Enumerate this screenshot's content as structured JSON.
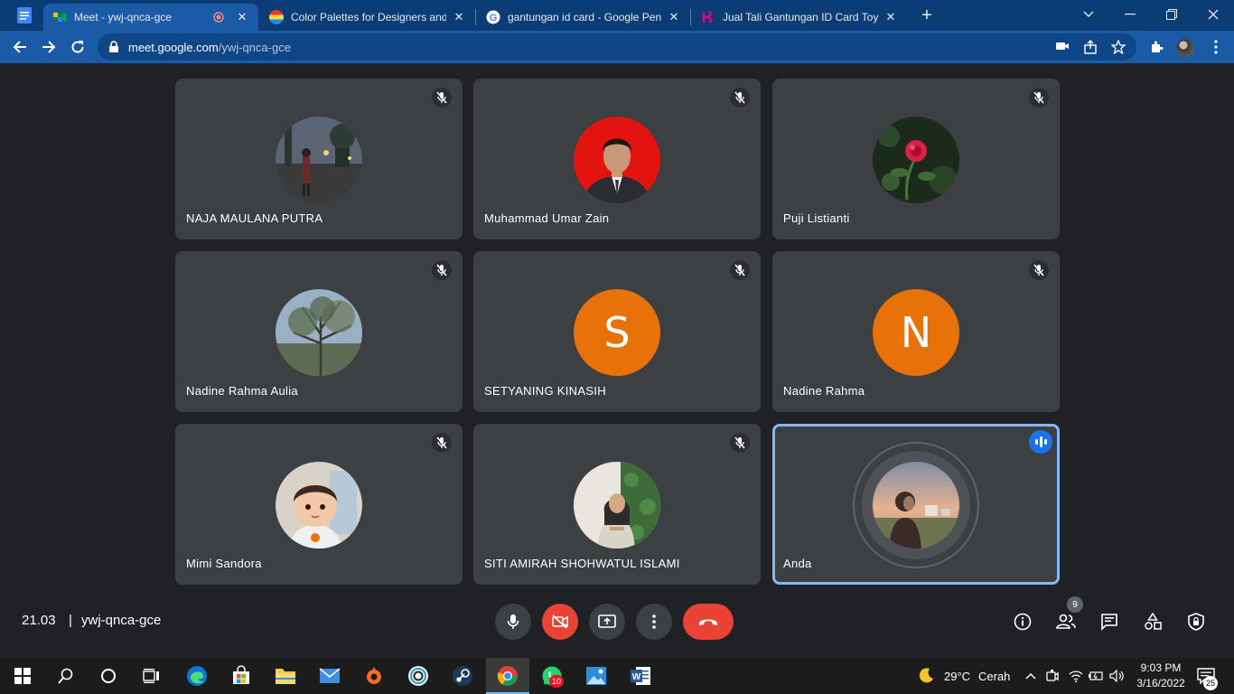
{
  "browser": {
    "tabs": [
      {
        "title": "Meet - ywj-qnca-gce",
        "active": true
      },
      {
        "title": "Color Palettes for Designers and A",
        "active": false
      },
      {
        "title": "gantungan id card - Google Pene",
        "active": false
      },
      {
        "title": "Jual Tali Gantungan ID Card Toyot",
        "active": false
      }
    ],
    "url_host": "meet.google.com",
    "url_path": "/ywj-qnca-gce"
  },
  "meet": {
    "participants": [
      {
        "name": "NAJA MAULANA PUTRA",
        "avatar": "photo-street-night",
        "muted": true
      },
      {
        "name": "Muhammad Umar Zain",
        "avatar": "photo-man-red-background",
        "muted": true
      },
      {
        "name": "Puji Listianti",
        "avatar": "photo-red-rose",
        "muted": true
      },
      {
        "name": "Nadine Rahma Aulia",
        "avatar": "photo-tree-sky",
        "muted": true
      },
      {
        "name": "SETYANING KINASIH",
        "avatar_letter": "S",
        "muted": true
      },
      {
        "name": "Nadine Rahma",
        "avatar_letter": "N",
        "muted": true
      },
      {
        "name": "Mimi Sandora",
        "avatar": "photo-cartoon-child",
        "muted": true
      },
      {
        "name": "SITI AMIRAH SHOHWATUL ISLAMI",
        "avatar": "photo-woman-hijab",
        "muted": true
      },
      {
        "name": "Anda",
        "avatar": "photo-sunset-person",
        "speaking": true
      }
    ],
    "meeting_time": "21.03",
    "separator": "|",
    "meeting_code": "ywj-qnca-gce",
    "people_count": "9",
    "accent_red": "#ea4335",
    "accent_orange": "#e8710a",
    "accent_blue": "#1a73e8"
  },
  "taskbar": {
    "weather_temp": "29°C",
    "weather_desc": "Cerah",
    "whatsapp_badge": "10",
    "time": "9:03 PM",
    "date": "3/16/2022",
    "notification_count": "25"
  }
}
